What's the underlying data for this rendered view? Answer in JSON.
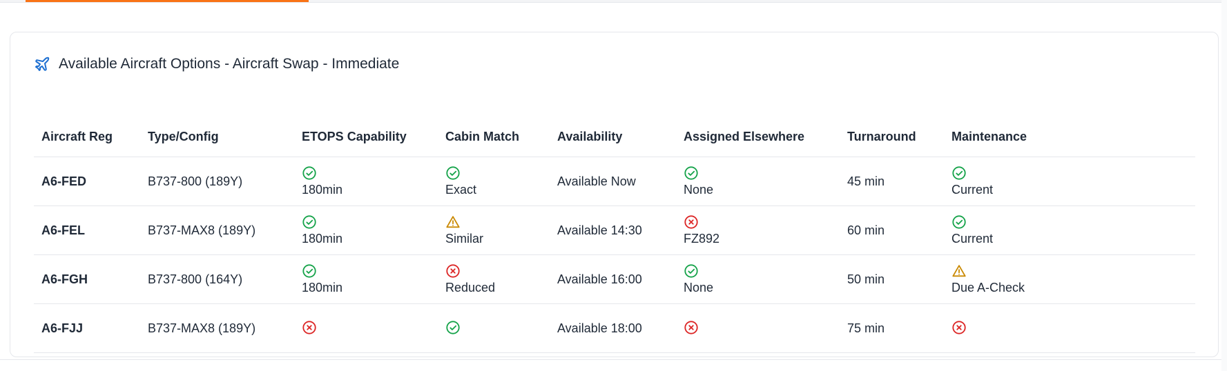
{
  "card": {
    "title": "Available Aircraft Options - Aircraft Swap - Immediate",
    "icon": "plane-icon"
  },
  "colors": {
    "ok": "#16a34a",
    "warn": "#ca8a04",
    "error": "#dc2626",
    "accent": "#f97316",
    "icon_blue": "#1d6fd1"
  },
  "table": {
    "headers": {
      "reg": "Aircraft Reg",
      "type": "Type/Config",
      "etops": "ETOPS Capability",
      "cabin": "Cabin Match",
      "availability": "Availability",
      "assigned": "Assigned Elsewhere",
      "turnaround": "Turnaround",
      "maintenance": "Maintenance"
    },
    "rows": [
      {
        "reg": "A6-FED",
        "type": "B737-800 (189Y)",
        "etops": {
          "status": "ok",
          "text": "180min"
        },
        "cabin": {
          "status": "ok",
          "text": "Exact"
        },
        "availability": "Available Now",
        "assigned": {
          "status": "ok",
          "text": "None"
        },
        "turnaround": "45 min",
        "maintenance": {
          "status": "ok",
          "text": "Current"
        }
      },
      {
        "reg": "A6-FEL",
        "type": "B737-MAX8 (189Y)",
        "etops": {
          "status": "ok",
          "text": "180min"
        },
        "cabin": {
          "status": "warn",
          "text": "Similar"
        },
        "availability": "Available 14:30",
        "assigned": {
          "status": "error",
          "text": "FZ892"
        },
        "turnaround": "60 min",
        "maintenance": {
          "status": "ok",
          "text": "Current"
        }
      },
      {
        "reg": "A6-FGH",
        "type": "B737-800 (164Y)",
        "etops": {
          "status": "ok",
          "text": "180min"
        },
        "cabin": {
          "status": "error",
          "text": "Reduced"
        },
        "availability": "Available 16:00",
        "assigned": {
          "status": "ok",
          "text": "None"
        },
        "turnaround": "50 min",
        "maintenance": {
          "status": "warn",
          "text": "Due A-Check"
        }
      },
      {
        "reg": "A6-FJJ",
        "type": "B737-MAX8 (189Y)",
        "etops": {
          "status": "error",
          "text": ""
        },
        "cabin": {
          "status": "ok",
          "text": ""
        },
        "availability": "Available 18:00",
        "assigned": {
          "status": "error",
          "text": ""
        },
        "turnaround": "75 min",
        "maintenance": {
          "status": "error",
          "text": ""
        }
      }
    ]
  }
}
